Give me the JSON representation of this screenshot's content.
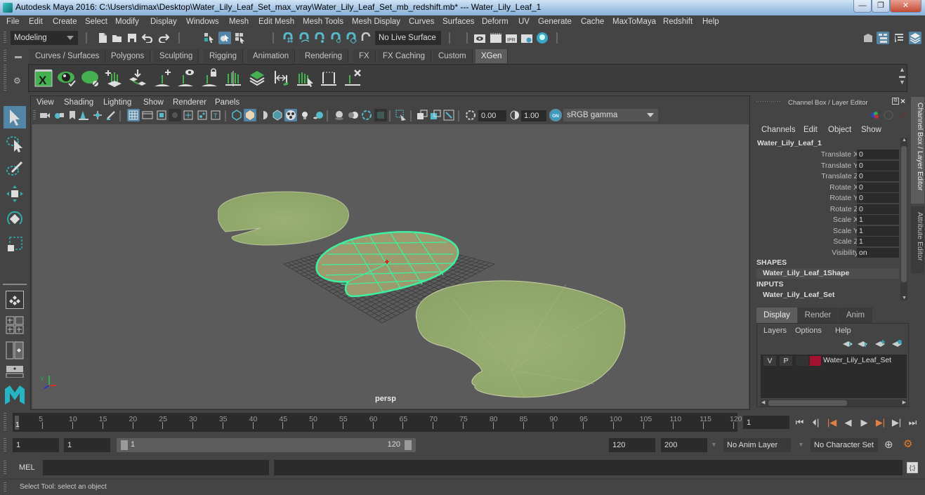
{
  "window": {
    "title": "Autodesk Maya 2016: C:\\Users\\dimax\\Desktop\\Water_Lily_Leaf_Set_max_vray\\Water_Lily_Leaf_Set_mb_redshift.mb*   ---   Water_Lily_Leaf_1",
    "minimize": "—",
    "maximize": "❐",
    "close": "✕"
  },
  "menubar": [
    "File",
    "Edit",
    "Create",
    "Select",
    "Modify",
    "Display",
    "Windows",
    "Mesh",
    "Edit Mesh",
    "Mesh Tools",
    "Mesh Display",
    "Curves",
    "Surfaces",
    "Deform",
    "UV",
    "Generate",
    "Cache",
    "MaxToMaya",
    "Redshift",
    "Help"
  ],
  "statusline": {
    "workspace": "Modeling",
    "live_surface": "No Live Surface"
  },
  "shelf_tabs": [
    "Curves / Surfaces",
    "Polygons",
    "Sculpting",
    "Rigging",
    "Animation",
    "Rendering",
    "FX",
    "FX Caching",
    "Custom",
    "XGen"
  ],
  "active_shelf_tab": "XGen",
  "shelf_icons": [
    "xgen-editor-icon",
    "preview-icon",
    "hide-icon",
    "add-description-icon",
    "place-guides-icon",
    "add-guide-icon",
    "guide-visibility-icon",
    "lock-guide-icon",
    "sculpt-guides-icon",
    "patches-icon",
    "guide-length-icon",
    "select-guides-icon",
    "guide-cage-icon",
    "delete-guide-icon"
  ],
  "viewport": {
    "menu": [
      "View",
      "Shading",
      "Lighting",
      "Show",
      "Renderer",
      "Panels"
    ],
    "exposure": "0.00",
    "gamma": "1.00",
    "color_mgmt_toggle": "ON",
    "color_space": "sRGB gamma",
    "camera_label": "persp",
    "axis": {
      "x": "x",
      "y": "y",
      "z": "z"
    }
  },
  "channel_box": {
    "title": "Channel Box / Layer Editor",
    "menu": [
      "Channels",
      "Edit",
      "Object",
      "Show"
    ],
    "object_name": "Water_Lily_Leaf_1",
    "channels": [
      {
        "label": "Translate X",
        "value": "0"
      },
      {
        "label": "Translate Y",
        "value": "0"
      },
      {
        "label": "Translate Z",
        "value": "0"
      },
      {
        "label": "Rotate X",
        "value": "0"
      },
      {
        "label": "Rotate Y",
        "value": "0"
      },
      {
        "label": "Rotate Z",
        "value": "0"
      },
      {
        "label": "Scale X",
        "value": "1"
      },
      {
        "label": "Scale Y",
        "value": "1"
      },
      {
        "label": "Scale Z",
        "value": "1"
      },
      {
        "label": "Visibility",
        "value": "on"
      }
    ],
    "shapes_header": "SHAPES",
    "shape_name": "Water_Lily_Leaf_1Shape",
    "inputs_header": "INPUTS",
    "input_name": "Water_Lily_Leaf_Set"
  },
  "layer_editor": {
    "tabs": [
      "Display",
      "Render",
      "Anim"
    ],
    "active_tab": "Display",
    "menu": [
      "Layers",
      "Options",
      "Help"
    ],
    "layers": [
      {
        "visible": "V",
        "playback": "P",
        "color": "#a5112f",
        "name": "Water_Lily_Leaf_Set"
      }
    ]
  },
  "side_tabs": [
    "Channel Box / Layer Editor",
    "Attribute Editor"
  ],
  "timeline": {
    "start_label": "1",
    "ticks": [
      5,
      10,
      15,
      20,
      25,
      30,
      35,
      40,
      45,
      50,
      55,
      60,
      65,
      70,
      75,
      80,
      85,
      90,
      95,
      100,
      105,
      110,
      115,
      120
    ],
    "min": 1,
    "max": 120,
    "current_frame": "1"
  },
  "range": {
    "start": "1",
    "playback_start": "1",
    "slider_start": "1",
    "slider_end": "120",
    "playback_end": "120",
    "end": "200",
    "anim_layer": "No Anim Layer",
    "character_set": "No Character Set"
  },
  "command_line": {
    "language": "MEL",
    "input": "",
    "result": ""
  },
  "help_line": "Select Tool: select an object"
}
